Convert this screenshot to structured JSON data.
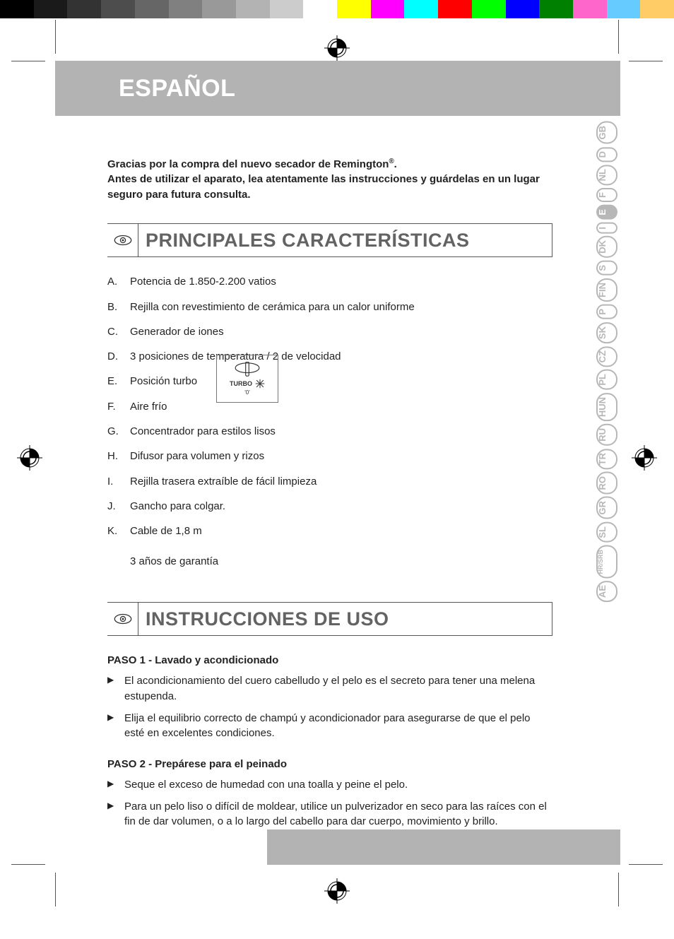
{
  "header": {
    "title": "ESPAÑOL"
  },
  "intro": {
    "line1_pre": "Gracias por la compra del nuevo secador de Remington",
    "line1_sup": "®",
    "line1_post": ".",
    "line2": "Antes de utilizar el aparato, lea atentamente las instrucciones y guárdelas en un lugar seguro para futura consulta."
  },
  "sections": {
    "features_title": "PRINCIPALES CARACTERÍSTICAS",
    "usage_title": "INSTRUCCIONES DE USO"
  },
  "features": [
    {
      "label": "A.",
      "text": "Potencia de 1.850-2.200 vatios"
    },
    {
      "label": "B.",
      "text": "Rejilla con revestimiento de cerámica para un calor uniforme"
    },
    {
      "label": "C.",
      "text": "Generador de iones"
    },
    {
      "label": "D.",
      "text": "3 posiciones de temperatura / 2 de velocidad"
    },
    {
      "label": "E.",
      "text": "Posición turbo"
    },
    {
      "label": "F.",
      "text": "Aire frío"
    },
    {
      "label": "G.",
      "text": "Concentrador para estilos lisos"
    },
    {
      "label": "H.",
      "text": "Difusor para volumen y rizos"
    },
    {
      "label": "I.",
      "text": "Rejilla trasera extraíble de fácil limpieza"
    },
    {
      "label": "J.",
      "text": "Gancho para colgar."
    },
    {
      "label": "K.",
      "text": "Cable de 1,8 m"
    }
  ],
  "warranty": "3 años de garantía",
  "turbo_label": "TURBO",
  "usage": {
    "step1_title": "PASO 1 - Lavado y acondicionado",
    "step1_bullets": [
      "El acondicionamiento del cuero cabelludo y el pelo es el secreto para tener una melena estupenda.",
      "Elija el equilibrio correcto de champú y acondicionador para asegurarse de que el pelo esté en excelentes condiciones."
    ],
    "step2_title": "PASO 2 - Prepárese para el peinado",
    "step2_bullets": [
      "Seque el exceso de humedad con una toalla y peine el pelo.",
      "Para un pelo liso o difícil de moldear, utilice un pulverizador en seco para las raíces con el fin de dar volumen, o a lo largo del cabello para dar cuerpo, movimiento y brillo."
    ]
  },
  "lang_tabs": [
    {
      "code": "GB",
      "active": false
    },
    {
      "code": "D",
      "active": false
    },
    {
      "code": "NL",
      "active": false
    },
    {
      "code": "F",
      "active": false
    },
    {
      "code": "E",
      "active": true
    },
    {
      "code": "I",
      "active": false
    },
    {
      "code": "DK",
      "active": false
    },
    {
      "code": "S",
      "active": false
    },
    {
      "code": "FIN",
      "active": false
    },
    {
      "code": "P",
      "active": false
    },
    {
      "code": "SK",
      "active": false
    },
    {
      "code": "CZ",
      "active": false
    },
    {
      "code": "PL",
      "active": false
    },
    {
      "code": "HUN",
      "active": false
    },
    {
      "code": "RU",
      "active": false
    },
    {
      "code": "TR",
      "active": false
    },
    {
      "code": "RO",
      "active": false
    },
    {
      "code": "GR",
      "active": false
    },
    {
      "code": "SL",
      "active": false
    },
    {
      "code": "HR/SRB",
      "active": false,
      "stack": true
    },
    {
      "code": "AE",
      "active": false
    }
  ],
  "color_bar": [
    "#000000",
    "#1a1a1a",
    "#333333",
    "#4d4d4d",
    "#666666",
    "#808080",
    "#999999",
    "#b3b3b3",
    "#cccccc",
    "#ffffff",
    "#ffff00",
    "#ff00ff",
    "#00ffff",
    "#ff0000",
    "#00ff00",
    "#0000ff",
    "#008000",
    "#ff66cc",
    "#66ccff",
    "#ffcc66"
  ]
}
